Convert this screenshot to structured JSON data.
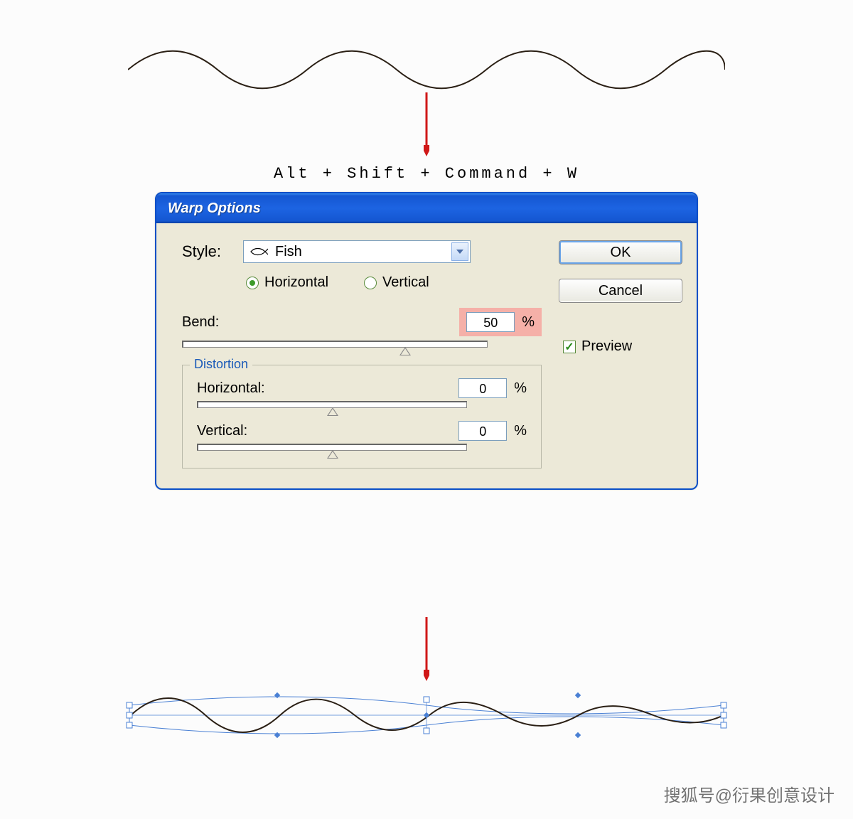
{
  "shortcut": "Alt + Shift + Command + W",
  "dialog": {
    "title": "Warp Options",
    "style_label": "Style:",
    "style_value": "Fish",
    "orientation": {
      "horizontal": "Horizontal",
      "vertical": "Vertical",
      "selected": "horizontal"
    },
    "bend": {
      "label": "Bend:",
      "value": "50",
      "unit": "%",
      "slider_pos": 0.73
    },
    "distortion": {
      "legend": "Distortion",
      "horizontal_label": "Horizontal:",
      "horizontal_value": "0",
      "vertical_label": "Vertical:",
      "vertical_value": "0",
      "unit": "%",
      "slider_pos": 0.5
    },
    "buttons": {
      "ok": "OK",
      "cancel": "Cancel",
      "preview": "Preview"
    }
  },
  "watermark": "搜狐号@衍果创意设计"
}
